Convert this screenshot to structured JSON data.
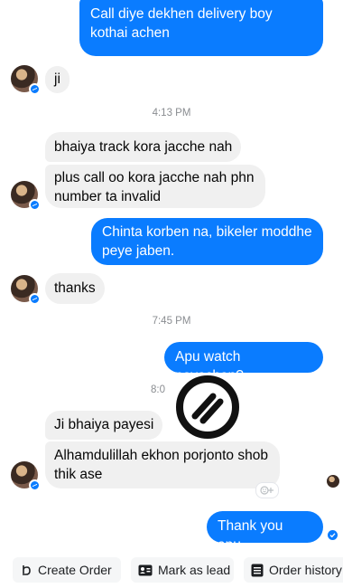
{
  "messages": {
    "m1": "Call diye dekhen delivery boy kothai achen",
    "m2": "ji",
    "ts1": "4:13 PM",
    "m3": "bhaiya track kora jacche nah",
    "m4": "plus call oo kora jacche nah phn number ta invalid",
    "m5": "Chinta korben na, bikeler moddhe peye jaben.",
    "m6": "thanks",
    "ts2": "7:45 PM",
    "m7": "Apu watch peyechen?",
    "ts3": "8:0",
    "m8": "Ji bhaiya payesi",
    "m9": "Alhamdulillah ekhon porjonto shob thik ase",
    "m10": "Thank you apu."
  },
  "toolbar": {
    "create_order": "Create Order",
    "mark_as_lead": "Mark as lead",
    "order_history": "Order history"
  },
  "colors": {
    "outgoing_bubble": "#0a7cff",
    "incoming_bubble": "#f0f0f0",
    "timestamp": "#8a8d91"
  },
  "icons": [
    "messenger-badge-icon",
    "watermark-logo-icon",
    "add-reaction-icon",
    "seen-avatar-icon",
    "sent-check-icon",
    "create-order-icon",
    "mark-as-lead-icon",
    "order-history-icon"
  ]
}
